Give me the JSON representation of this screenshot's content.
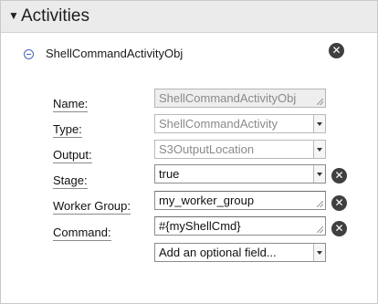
{
  "panel": {
    "title": "Activities"
  },
  "object": {
    "name": "ShellCommandActivityObj"
  },
  "fields": {
    "name": {
      "label": "Name:",
      "value": "ShellCommandActivityObj"
    },
    "type": {
      "label": "Type:",
      "value": "ShellCommandActivity"
    },
    "output": {
      "label": "Output:",
      "value": "S3OutputLocation"
    },
    "stage": {
      "label": "Stage:",
      "value": "true"
    },
    "worker_group": {
      "label": "Worker Group:",
      "value": "my_worker_group"
    },
    "command": {
      "label": "Command:",
      "value": "#{myShellCmd}"
    }
  },
  "add_field": {
    "placeholder": "Add an optional field..."
  },
  "icons": {
    "remove": "close-icon",
    "collapse": "collapse-icon",
    "expand": "triangle-down-icon"
  },
  "colors": {
    "header_bg": "#ebebeb",
    "collapse_blue": "#4a66b8",
    "remove_btn": "#3f3f3f"
  }
}
